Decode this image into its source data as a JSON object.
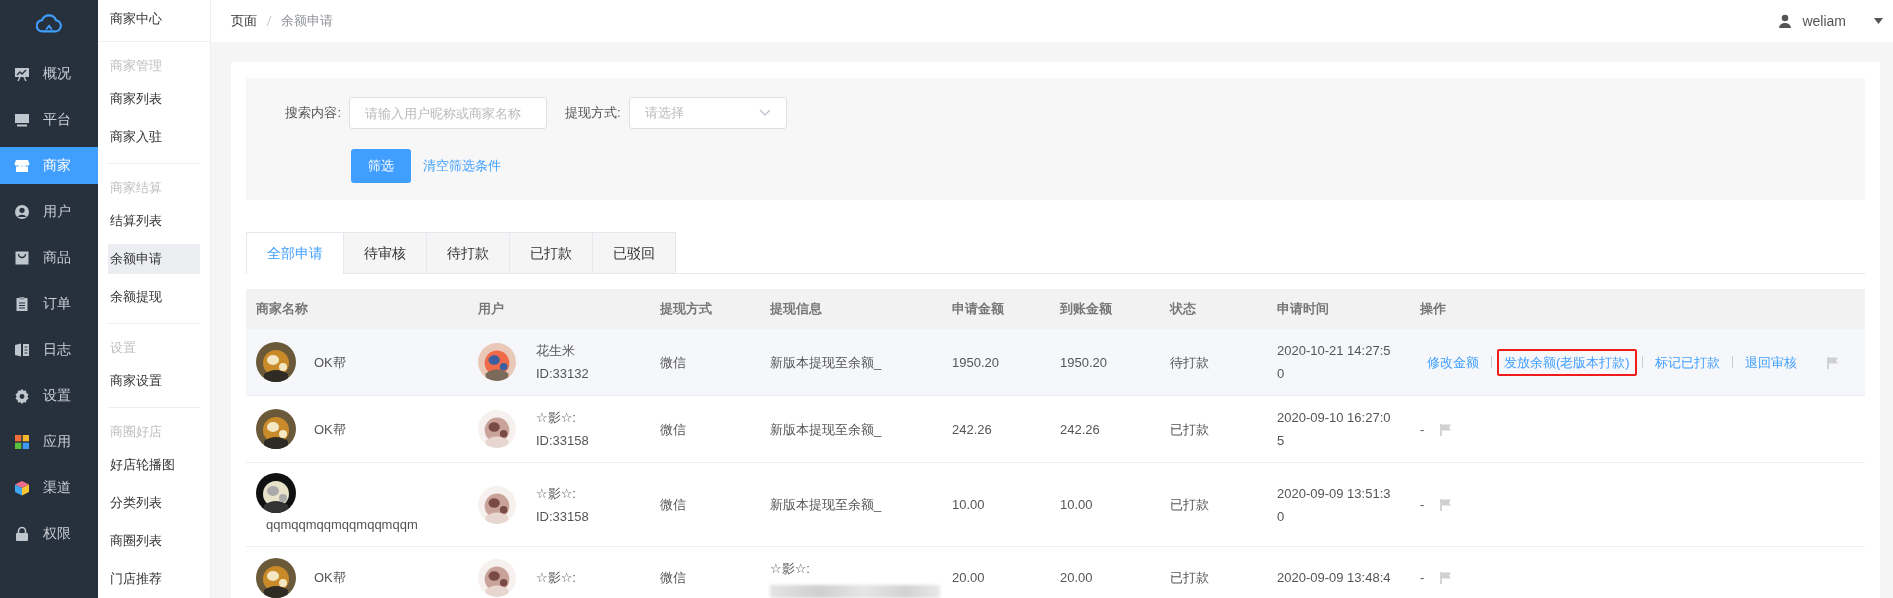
{
  "main_nav": [
    {
      "kind": "overview",
      "label": "概况",
      "selected": false
    },
    {
      "kind": "platform",
      "label": "平台",
      "selected": false
    },
    {
      "kind": "merchant",
      "label": "商家",
      "selected": true
    },
    {
      "kind": "user",
      "label": "用户",
      "selected": false
    },
    {
      "kind": "goods",
      "label": "商品",
      "selected": false
    },
    {
      "kind": "order",
      "label": "订单",
      "selected": false
    },
    {
      "kind": "log",
      "label": "日志",
      "selected": false
    },
    {
      "kind": "settings",
      "label": "设置",
      "selected": false
    },
    {
      "kind": "apps",
      "label": "应用",
      "selected": false
    },
    {
      "kind": "channel",
      "label": "渠道",
      "selected": false
    },
    {
      "kind": "permission",
      "label": "权限",
      "selected": false
    }
  ],
  "sub_nav": {
    "title": "商家中心",
    "groups": [
      {
        "heading": "商家管理",
        "items": [
          {
            "label": "商家列表",
            "selected": false
          },
          {
            "label": "商家入驻",
            "selected": false
          }
        ]
      },
      {
        "heading": "商家结算",
        "items": [
          {
            "label": "结算列表",
            "selected": false
          },
          {
            "label": "余额申请",
            "selected": true
          },
          {
            "label": "余额提现",
            "selected": false
          }
        ]
      },
      {
        "heading": "设置",
        "items": [
          {
            "label": "商家设置",
            "selected": false
          }
        ]
      },
      {
        "heading": "商圈好店",
        "items": [
          {
            "label": "好店轮播图",
            "selected": false
          },
          {
            "label": "分类列表",
            "selected": false
          },
          {
            "label": "商圈列表",
            "selected": false
          },
          {
            "label": "门店推荐",
            "selected": false
          }
        ]
      }
    ]
  },
  "breadcrumb": [
    "页面",
    "余额申请"
  ],
  "user": {
    "name": "weliam"
  },
  "filter": {
    "search_label": "搜索内容:",
    "search_placeholder": "请输入用户昵称或商家名称",
    "method_label": "提现方式:",
    "method_placeholder": "请选择",
    "filter_button": "筛选",
    "clear_link": "清空筛选条件"
  },
  "tabs": [
    {
      "label": "全部申请",
      "selected": true
    },
    {
      "label": "待审核",
      "selected": false
    },
    {
      "label": "待打款",
      "selected": false
    },
    {
      "label": "已打款",
      "selected": false
    },
    {
      "label": "已驳回",
      "selected": false
    }
  ],
  "table": {
    "columns": [
      "商家名称",
      "用户",
      "提现方式",
      "提现信息",
      "申请金额",
      "到账金额",
      "状态",
      "申请时间",
      "操作"
    ],
    "rows": [
      {
        "hovered": true,
        "merchant": "OK帮",
        "user": "花生米",
        "user_id": "ID:33132",
        "method": "微信",
        "info": "新版本提现至余额_",
        "redacted": false,
        "amount": "1950.20",
        "received": "1950.20",
        "status": "待打款",
        "time": "2020-10-21 14:27:50",
        "actions": [
          {
            "label": "修改金额",
            "highlighted": false
          },
          {
            "label": "发放余额(老版本打款)",
            "highlighted": true
          },
          {
            "label": "标记已打款",
            "highlighted": false
          },
          {
            "label": "退回审核",
            "highlighted": false
          }
        ]
      },
      {
        "hovered": false,
        "merchant": "OK帮",
        "user": "☆影☆:",
        "user_id": "ID:33158",
        "method": "微信",
        "info": "新版本提现至余额_",
        "redacted": false,
        "amount": "242.26",
        "received": "242.26",
        "status": "已打款",
        "time": "2020-09-10 16:27:05",
        "no_action": "-"
      },
      {
        "hovered": false,
        "merchant": "qqmqqmqqmqqmqqmqqm",
        "user": "☆影☆:",
        "user_id": "ID:33158",
        "method": "微信",
        "info": "新版本提现至余额_",
        "redacted": false,
        "amount": "10.00",
        "received": "10.00",
        "status": "已打款",
        "time": "2020-09-09 13:51:30",
        "no_action": "-"
      },
      {
        "hovered": false,
        "merchant": "OK帮",
        "user": "☆影☆:",
        "method": "微信",
        "info": "☆影☆:",
        "redacted": true,
        "amount": "20.00",
        "received": "20.00",
        "status": "已打款",
        "time": "2020-09-09 13:48:4",
        "no_action": "-"
      }
    ]
  }
}
